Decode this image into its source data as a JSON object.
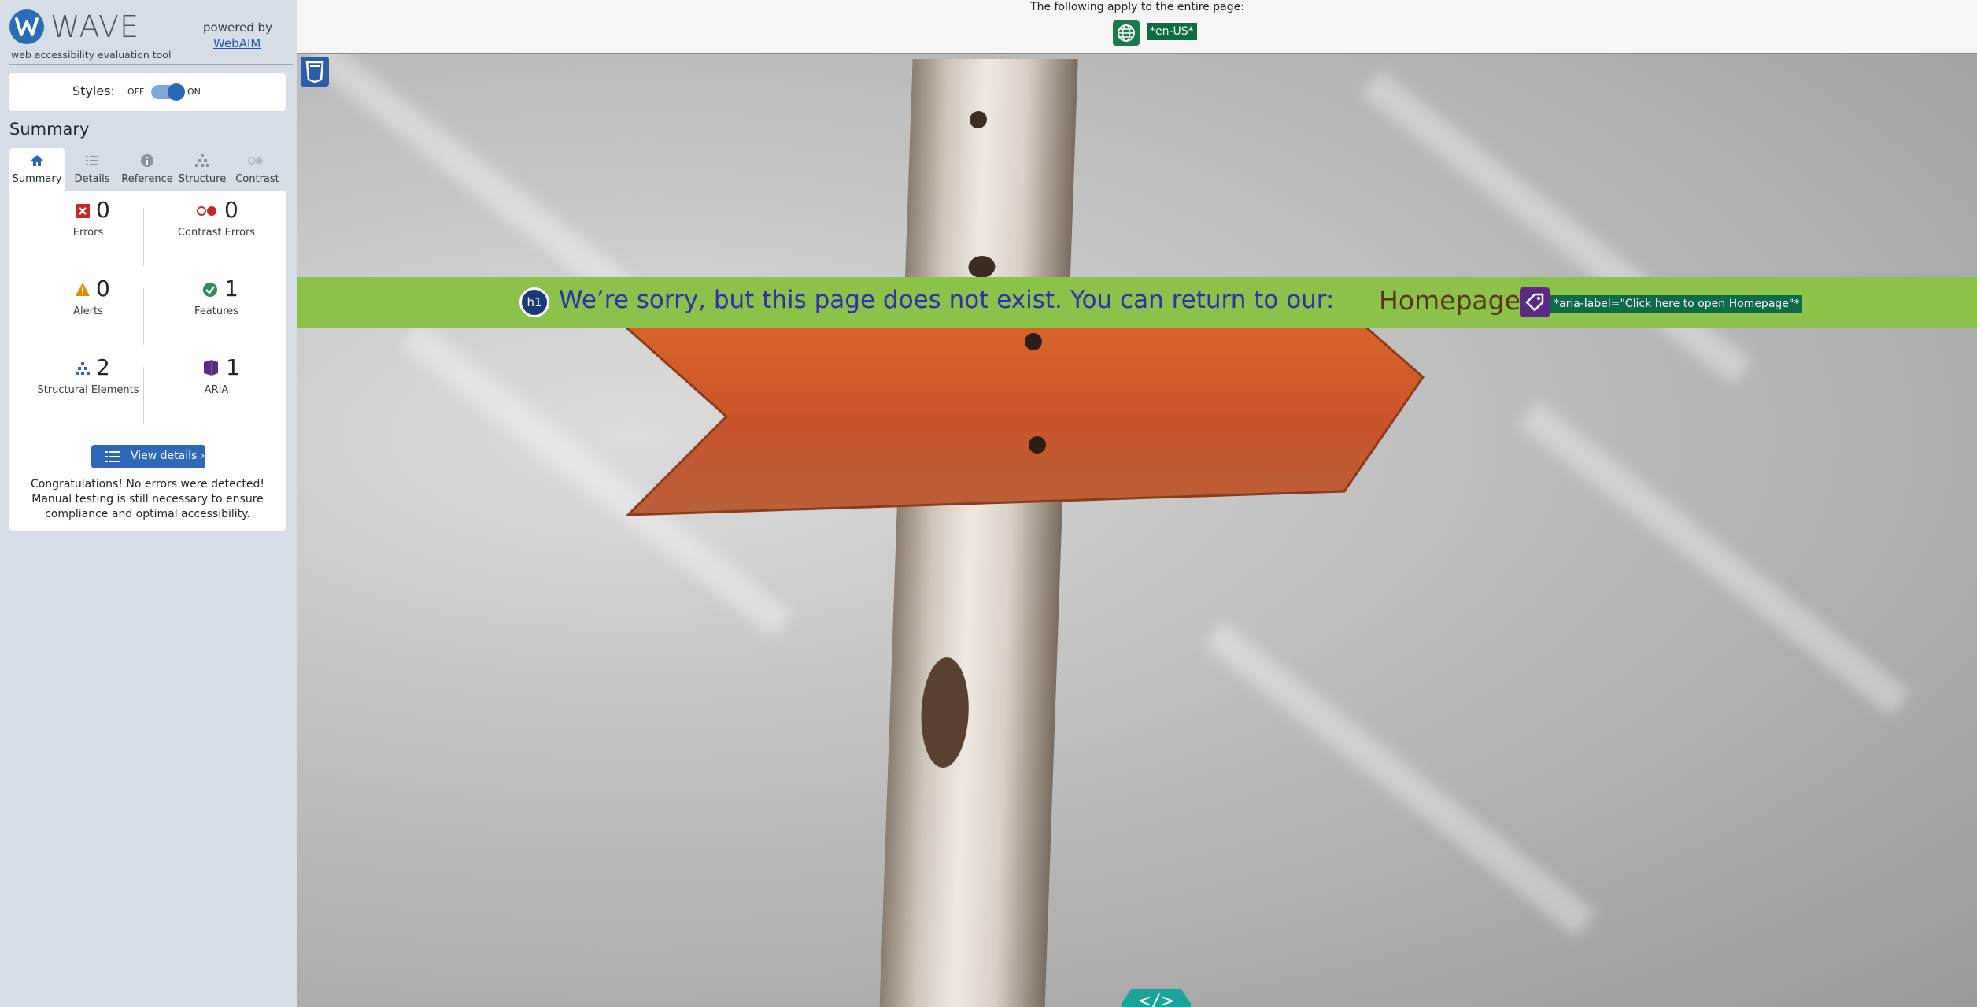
{
  "sidebar": {
    "brand": {
      "name": "WAVE",
      "tagline": "web accessibility evaluation tool",
      "powered_by": "powered by",
      "powered_link": "WebAIM"
    },
    "styles": {
      "label": "Styles:",
      "off": "OFF",
      "on": "ON",
      "enabled": true
    },
    "section_title": "Summary",
    "tabs": [
      {
        "label": "Summary",
        "icon": "home-icon",
        "active": true
      },
      {
        "label": "Details",
        "icon": "list-icon",
        "active": false
      },
      {
        "label": "Reference",
        "icon": "info-icon",
        "active": false
      },
      {
        "label": "Structure",
        "icon": "structure-icon",
        "active": false
      },
      {
        "label": "Contrast",
        "icon": "contrast-icon",
        "active": false
      }
    ],
    "stats": [
      {
        "count": "0",
        "label": "Errors",
        "icon": "error-icon",
        "color": "#c62828"
      },
      {
        "count": "0",
        "label": "Contrast Errors",
        "icon": "contrast-error-icon",
        "color": "#c62828"
      },
      {
        "count": "0",
        "label": "Alerts",
        "icon": "alert-icon",
        "color": "#e08a00"
      },
      {
        "count": "1",
        "label": "Features",
        "icon": "feature-icon",
        "color": "#2e8b57"
      },
      {
        "count": "2",
        "label": "Structural Elements",
        "icon": "structure-icon",
        "color": "#2c67b5"
      },
      {
        "count": "1",
        "label": "ARIA",
        "icon": "aria-icon",
        "color": "#5b2a86"
      }
    ],
    "view_details": "View details ›",
    "message": "Congratulations! No errors were detected! Manual testing is still necessary to ensure compliance and optimal accessibility."
  },
  "page": {
    "note": "The following apply to the entire page:",
    "lang_tag": "*en-US*",
    "heading_badge": "h1",
    "notice": "We’re sorry, but this page does not exist. You can return to our:",
    "link_text": "Homepage",
    "aria_label": "*aria-label=\"Click here to open Homepage\"*",
    "code_badge": "</>"
  },
  "colors": {
    "sidebar_bg": "#d6dde6",
    "accent": "#2f68b8",
    "notice_bar": "#8bc34a",
    "tag_green": "#0f6b45"
  }
}
